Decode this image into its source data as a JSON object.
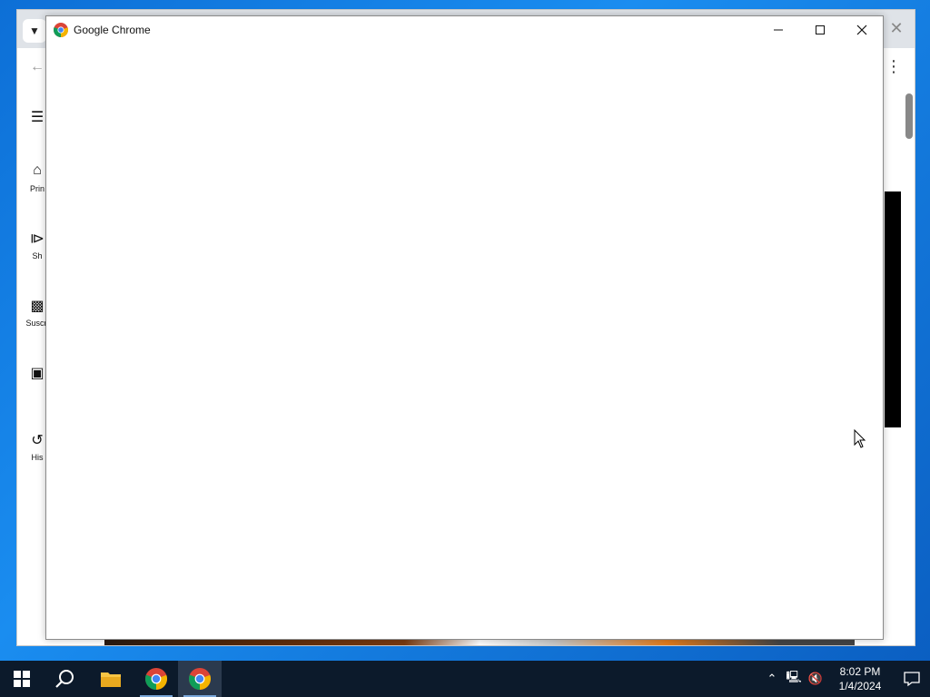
{
  "foreground_window": {
    "title": "Google Chrome",
    "controls": {
      "minimize": "—",
      "maximize": "☐",
      "close": "✕"
    }
  },
  "background_window": {
    "close_glyph": "✕",
    "sidebar": [
      {
        "label": "Prin",
        "icon": "home-icon"
      },
      {
        "label": "Sh",
        "icon": "shorts-icon"
      },
      {
        "label": "Suscri",
        "icon": "subscriptions-icon"
      },
      {
        "label": "",
        "icon": "library-icon"
      },
      {
        "label": "His",
        "icon": "history-icon"
      }
    ]
  },
  "taskbar": {
    "time": "8:02 PM",
    "date": "1/4/2024",
    "apps": [
      "start-icon",
      "search-icon",
      "file-explorer-icon",
      "chrome-icon",
      "chrome-icon"
    ]
  }
}
